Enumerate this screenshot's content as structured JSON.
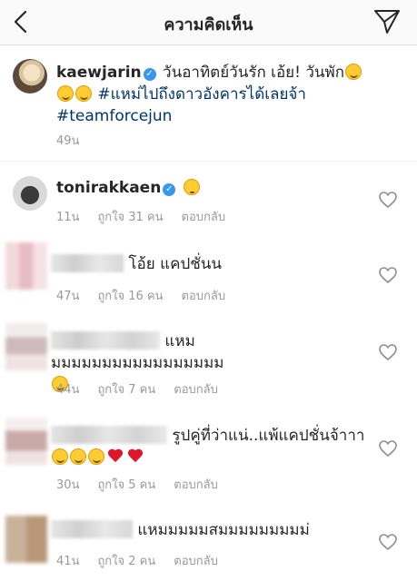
{
  "header": {
    "title": "ความคิดเห็น",
    "back_icon": "chevron-left-icon",
    "send_icon": "paper-plane-icon"
  },
  "caption": {
    "username": "kaewjarin",
    "text": "วันอาทิตย์วันรัก เอ้ย! วันพัก",
    "hashtag_1": "#แหม่ไปถึงดาวอังคารได้เลยจ้า",
    "hashtag_2": "#teamforcejun",
    "time": "49น"
  },
  "comments": [
    {
      "username": "tonirakkaen",
      "text": "",
      "time": "11น",
      "likes": "ถูกใจ 31 คน",
      "reply": "ตอบกลับ"
    },
    {
      "username": "",
      "text": "โอ้ย แคปชั่นน",
      "time": "47น",
      "likes": "ถูกใจ 16 คน",
      "reply": "ตอบกลับ"
    },
    {
      "username": "",
      "text": "แหมมมมมมมมมมมมมมมมมม",
      "time": "44น",
      "likes": "ถูกใจ 7 คน",
      "reply": "ตอบกลับ"
    },
    {
      "username": "",
      "text": "รูปคู่ที่ว่าแน่..แพ้แคปชั่นจ้าาา",
      "time": "30น",
      "likes": "ถูกใจ 5 คน",
      "reply": "ตอบกลับ"
    },
    {
      "username": "",
      "text": "แหมมมมมสมมมมมมมมม่",
      "time": "41น",
      "likes": "ถูกใจ 2 คน",
      "reply": "ตอบกลับ"
    }
  ],
  "colors": {
    "verified": "#3897f0",
    "hashtag": "#003569",
    "meta_text": "#999999",
    "heart": "#e0162b"
  }
}
